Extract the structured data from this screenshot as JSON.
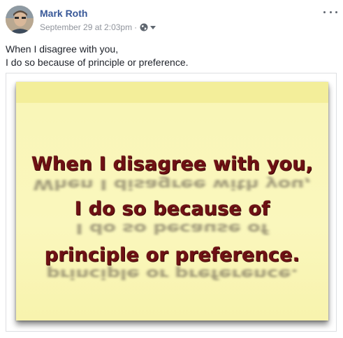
{
  "post": {
    "author": "Mark Roth",
    "timestamp": "September 29 at 2:03pm",
    "separator": "·",
    "audience_icon": "globe-icon",
    "menu_icon": "more-options-icon",
    "message_lines": [
      "When I disagree with you,",
      "I do so because of principle or preference."
    ]
  },
  "image": {
    "lines": [
      "When I disagree with you,",
      "I do so because of",
      "principle or preference."
    ]
  },
  "colors": {
    "author_link": "#385898",
    "meta_text": "#90949c",
    "note_background": "#faf7bd",
    "note_text": "#6e1114"
  }
}
